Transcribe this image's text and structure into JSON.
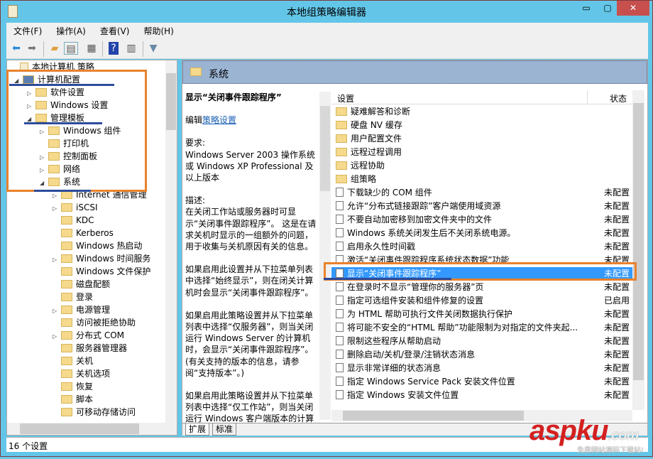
{
  "window": {
    "title": "本地组策略编辑器",
    "minimize": "▭",
    "maximize": "▢",
    "close": "✕"
  },
  "menu": [
    "文件(F)",
    "操作(A)",
    "查看(V)",
    "帮助(H)"
  ],
  "toolbar": {
    "icons": [
      "back-arrow-icon",
      "forward-arrow-icon",
      "up-folder-icon",
      "show-hide-tree-icon",
      "export-list-icon",
      "help-icon",
      "properties-pane-icon",
      "filter-icon"
    ]
  },
  "tree": {
    "items": [
      {
        "label": "本地计算机 策略",
        "level": 0,
        "expander": ""
      },
      {
        "label": "计算机配置",
        "level": 1,
        "expander": "◢"
      },
      {
        "label": "软件设置",
        "level": 2,
        "expander": "▷"
      },
      {
        "label": "Windows 设置",
        "level": 2,
        "expander": "▷"
      },
      {
        "label": "管理模板",
        "level": 2,
        "expander": "◢"
      },
      {
        "label": "Windows 组件",
        "level": 3,
        "expander": "▷"
      },
      {
        "label": "打印机",
        "level": 3,
        "expander": ""
      },
      {
        "label": "控制面板",
        "level": 3,
        "expander": "▷"
      },
      {
        "label": "网络",
        "level": 3,
        "expander": "▷"
      },
      {
        "label": "系统",
        "level": 3,
        "expander": "◢"
      },
      {
        "label": "Internet 通信管理",
        "level": 4,
        "expander": "▷"
      },
      {
        "label": "iSCSI",
        "level": 4,
        "expander": "▷"
      },
      {
        "label": "KDC",
        "level": 4,
        "expander": ""
      },
      {
        "label": "Kerberos",
        "level": 4,
        "expander": ""
      },
      {
        "label": "Windows 热启动",
        "level": 4,
        "expander": ""
      },
      {
        "label": "Windows 时间服务",
        "level": 4,
        "expander": "▷"
      },
      {
        "label": "Windows 文件保护",
        "level": 4,
        "expander": ""
      },
      {
        "label": "磁盘配额",
        "level": 4,
        "expander": ""
      },
      {
        "label": "登录",
        "level": 4,
        "expander": ""
      },
      {
        "label": "电源管理",
        "level": 4,
        "expander": "▷"
      },
      {
        "label": "访问被拒绝协助",
        "level": 4,
        "expander": ""
      },
      {
        "label": "分布式 COM",
        "level": 4,
        "expander": "▷"
      },
      {
        "label": "服务器管理器",
        "level": 4,
        "expander": ""
      },
      {
        "label": "关机",
        "level": 4,
        "expander": ""
      },
      {
        "label": "关机选项",
        "level": 4,
        "expander": ""
      },
      {
        "label": "恢复",
        "level": 4,
        "expander": ""
      },
      {
        "label": "脚本",
        "level": 4,
        "expander": ""
      },
      {
        "label": "可移动存储访问",
        "level": 4,
        "expander": ""
      }
    ]
  },
  "right": {
    "header": "系统",
    "description": {
      "title": "显示“关闭事件跟踪程序”",
      "edit_prefix": "编辑",
      "edit_link": "策略设置",
      "requirements": "要求:\nWindows Server 2003 操作系统或 Windows XP Professional 及以上版本",
      "paragraphs": [
        "描述:\n在关闭工作站或服务器时可显示“关闭事件跟踪程序”。 这是在请求关机时显示的一组额外的问题，用于收集与关机原因有关的信息。",
        "如果启用此设置并从下拉菜单列表中选择“始终显示”，则在闭关计算机时会显示“关闭事件跟踪程序”。",
        "如果启用此策略设置并从下拉菜单列表中选择“仅服务器”，则当关闭运行 Windows Server 的计算机时，会显示“关闭事件跟踪程序”。(有关支持的版本的信息，请参阅“支持版本”。)",
        "如果启用此策略设置并从下拉菜单列表中选择“仅工作站”，则当关闭运行 Windows 客户端版本的计算机时，会显示“关闭事件跟踪程序”。(有关支持的版本的信息，请"
      ]
    },
    "list": {
      "col_setting": "设置",
      "col_state": "状态",
      "rows": [
        {
          "type": "folder",
          "name": "疑难解答和诊断",
          "state": ""
        },
        {
          "type": "folder",
          "name": "硬盘 NV 缓存",
          "state": ""
        },
        {
          "type": "folder",
          "name": "用户配置文件",
          "state": ""
        },
        {
          "type": "folder",
          "name": "远程过程调用",
          "state": ""
        },
        {
          "type": "folder",
          "name": "远程协助",
          "state": ""
        },
        {
          "type": "folder",
          "name": "组策略",
          "state": ""
        },
        {
          "type": "policy",
          "name": "下载缺少的 COM 组件",
          "state": "未配置"
        },
        {
          "type": "policy",
          "name": "允许“分布式链接跟踪”客户端使用域资源",
          "state": "未配置"
        },
        {
          "type": "policy",
          "name": "不要自动加密移到加密文件夹中的文件",
          "state": "未配置"
        },
        {
          "type": "policy",
          "name": "Windows 系统关闭发生后不关闭系统电源。",
          "state": "未配置"
        },
        {
          "type": "policy",
          "name": "启用永久性时间戳",
          "state": "未配置"
        },
        {
          "type": "policy",
          "name": "激活“关闭事件跟踪程序系统状态数据”功能",
          "state": "未配置"
        },
        {
          "type": "policy",
          "name": "显示“关闭事件跟踪程序”",
          "state": "未配置",
          "selected": true
        },
        {
          "type": "policy",
          "name": "在登录时不显示“管理你的服务器”页",
          "state": "未配置"
        },
        {
          "type": "policy",
          "name": "指定可选组件安装和组件修复的设置",
          "state": "已启用"
        },
        {
          "type": "policy",
          "name": "为 HTML 帮助可执行文件关闭数据执行保护",
          "state": "未配置"
        },
        {
          "type": "policy",
          "name": "将可能不安全的“HTML 帮助”功能限制为对指定的文件夹起...",
          "state": "未配置"
        },
        {
          "type": "policy",
          "name": "限制这些程序从帮助启动",
          "state": "未配置"
        },
        {
          "type": "policy",
          "name": "删除启动/关机/登录/注销状态消息",
          "state": "未配置"
        },
        {
          "type": "policy",
          "name": "显示非常详细的状态消息",
          "state": "未配置"
        },
        {
          "type": "policy",
          "name": "指定 Windows Service Pack 安装文件位置",
          "state": "未配置"
        },
        {
          "type": "policy",
          "name": "指定 Windows 安装文件位置",
          "state": "未配置"
        }
      ]
    },
    "tabs": [
      "扩展",
      "标准"
    ]
  },
  "status": "16 个设置",
  "watermark": {
    "brand": "aspku",
    "suffix": ".com",
    "tagline": "免费网站源码下载站!"
  },
  "colors": {
    "selection": "#3399ff",
    "annotation_box": "#e9822c",
    "annotation_underline": "#2c4c9c",
    "header_band": "#9ab4d2"
  }
}
